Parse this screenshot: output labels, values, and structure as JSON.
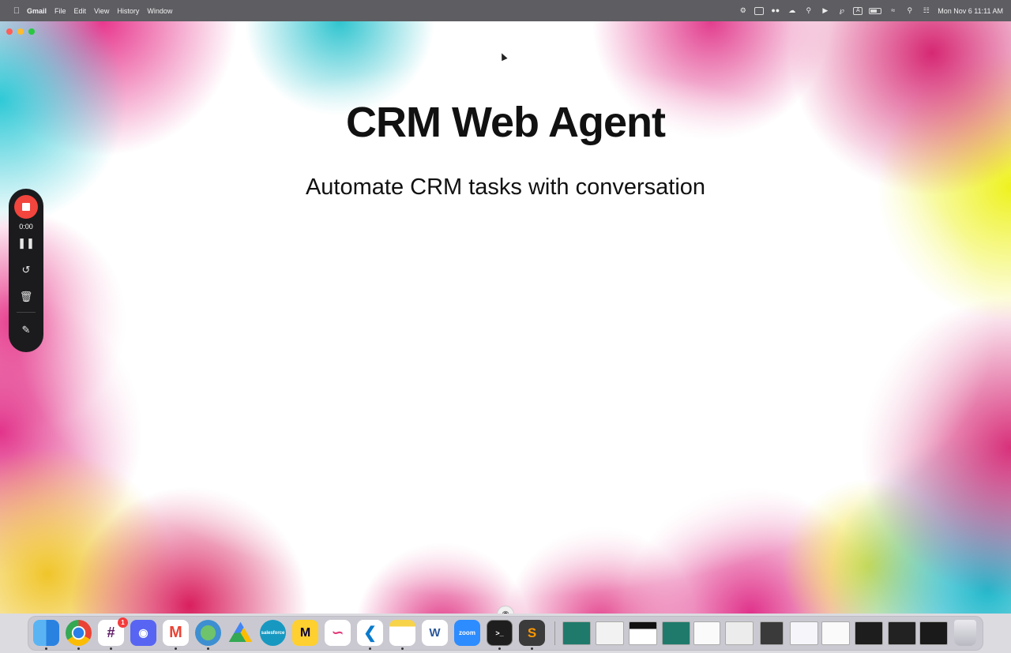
{
  "menubar": {
    "app_name": "Gmail",
    "menus": [
      "File",
      "Edit",
      "View",
      "History",
      "Window"
    ],
    "clock": "Mon Nov 6  11:11 AM"
  },
  "slide": {
    "title": "CRM Web Agent",
    "subtitle": "Automate CRM tasks with conversation"
  },
  "recorder": {
    "elapsed": "0:00",
    "icons": [
      "stop-icon",
      "pause-icon",
      "restart-icon",
      "trash-icon",
      "pencil-icon"
    ]
  },
  "dock": {
    "apps": [
      {
        "name": "finder",
        "label": ""
      },
      {
        "name": "chrome",
        "label": ""
      },
      {
        "name": "slack",
        "label": "",
        "badge": "1"
      },
      {
        "name": "discord",
        "label": ""
      },
      {
        "name": "gmail",
        "label": "M"
      },
      {
        "name": "vpn",
        "label": ""
      },
      {
        "name": "google-drive",
        "label": ""
      },
      {
        "name": "salesforce",
        "label": "salesforce"
      },
      {
        "name": "miro",
        "label": "M"
      },
      {
        "name": "freeform",
        "label": ""
      },
      {
        "name": "vscode",
        "label": ""
      },
      {
        "name": "notes",
        "label": ""
      },
      {
        "name": "word",
        "label": "W"
      },
      {
        "name": "zoom",
        "label": "zoom"
      },
      {
        "name": "terminal",
        "label": ">_"
      },
      {
        "name": "sublime-text",
        "label": "S"
      }
    ]
  },
  "colors": {
    "menubar_bg": "#5d5d62",
    "record_red": "#f2453d",
    "recorder_bg": "#1b1b1d"
  }
}
